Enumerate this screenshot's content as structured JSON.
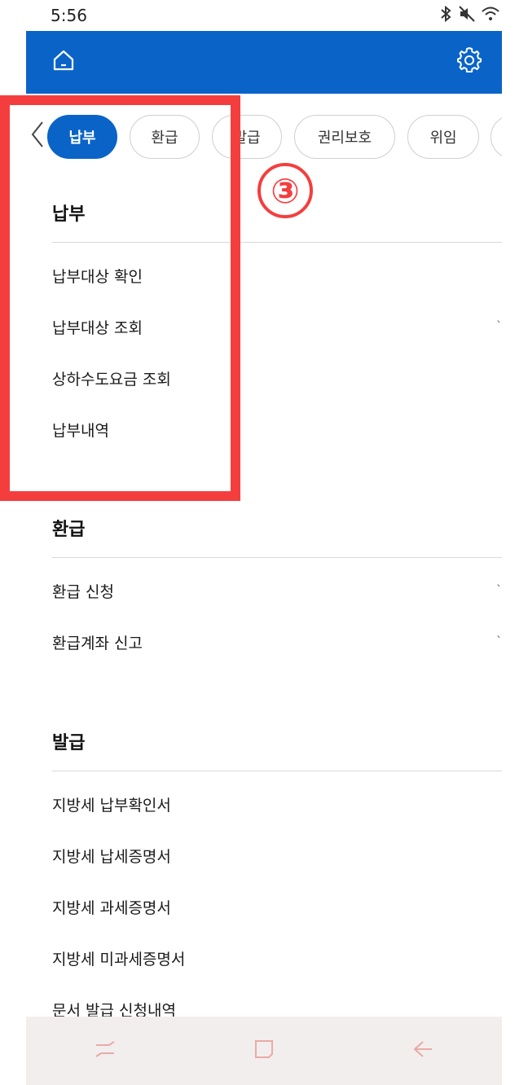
{
  "status_bar": {
    "time": "5:56"
  },
  "header": {
    "home_icon": "home-icon",
    "settings_icon": "gear-icon"
  },
  "tabs": [
    {
      "label": "납부",
      "active": true
    },
    {
      "label": "환급",
      "active": false
    },
    {
      "label": "발급",
      "active": false
    },
    {
      "label": "권리보호",
      "active": false
    },
    {
      "label": "위임",
      "active": false
    }
  ],
  "annotation": {
    "step": "③",
    "color": "#f43e3e"
  },
  "sections": [
    {
      "title": "납부",
      "items": [
        "납부대상 확인",
        "납부대상 조회",
        "상하수도요금 조회",
        "납부내역"
      ]
    },
    {
      "title": "환급",
      "items": [
        "환급 신청",
        "환급계좌 신고"
      ]
    },
    {
      "title": "발급",
      "items": [
        "지방세 납부확인서",
        "지방세 납세증명서",
        "지방세 과세증명서",
        "지방세 미과세증명서",
        "문서 발급 신청내역"
      ]
    }
  ],
  "colors": {
    "brand": "#0a64c8",
    "nav_bg": "#f3eeee",
    "nav_icon": "#e8aaa6"
  }
}
